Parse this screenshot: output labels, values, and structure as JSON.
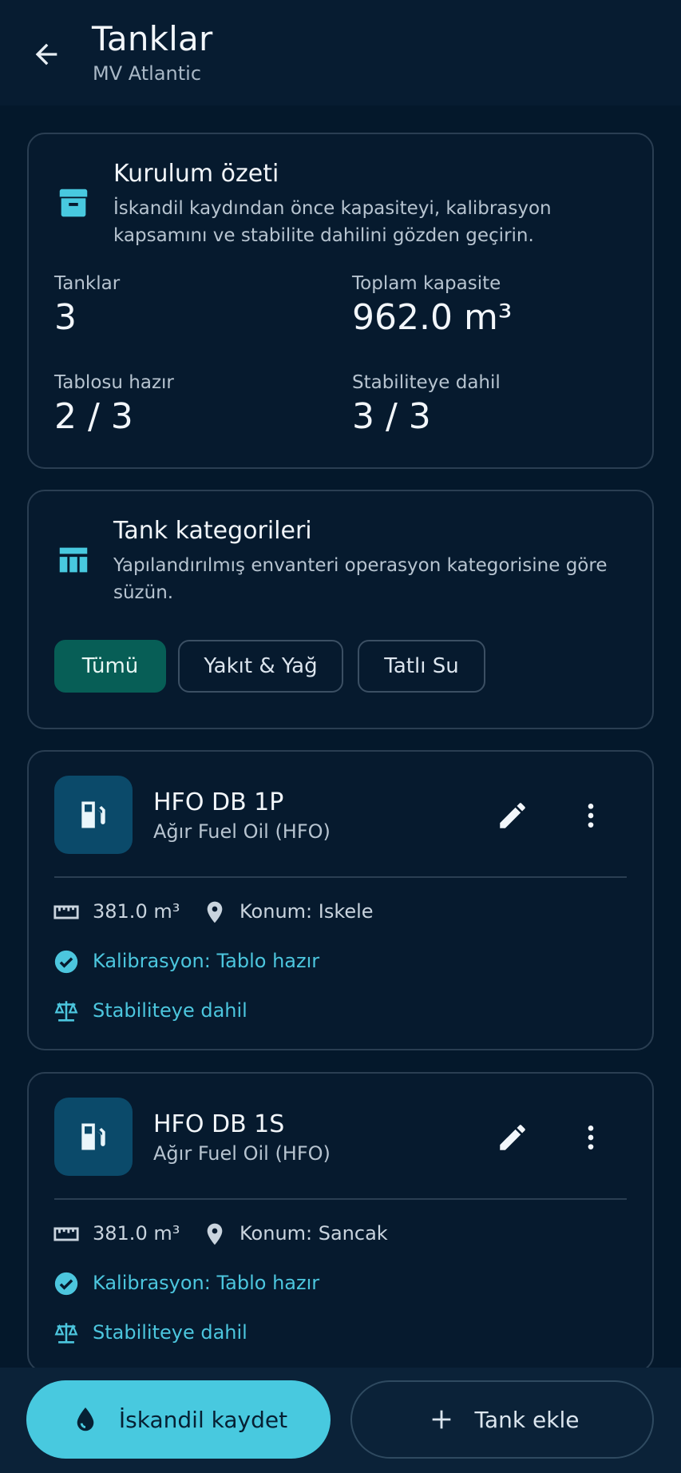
{
  "header": {
    "title": "Tanklar",
    "subtitle": "MV Atlantic",
    "back_icon": "arrow-back-icon"
  },
  "summary": {
    "title": "Kurulum özeti",
    "description": "İskandil kaydından önce kapasiteyi, kalibrasyon kapsamını ve stabilite dahilini gözden geçirin.",
    "icon": "archive-box-icon",
    "stats": [
      {
        "label": "Tanklar",
        "value": "3"
      },
      {
        "label": "Toplam kapasite",
        "value": "962.0 m³"
      },
      {
        "label": "Tablosu hazır",
        "value": "2 / 3"
      },
      {
        "label": "Stabiliteye dahil",
        "value": "3 / 3"
      }
    ]
  },
  "categories": {
    "title": "Tank kategorileri",
    "description": "Yapılandırılmış envanteri operasyon kategorisine göre süzün.",
    "icon": "table-columns-icon",
    "chips": [
      {
        "label": "Tümü",
        "selected": true
      },
      {
        "label": "Yakıt & Yağ",
        "selected": false
      },
      {
        "label": "Tatlı Su",
        "selected": false
      }
    ]
  },
  "tanks": [
    {
      "name": "HFO DB 1P",
      "type": "Ağır Fuel Oil (HFO)",
      "capacity": "381.0 m³",
      "location": "Konum: Iskele",
      "calibration": "Kalibrasyon: Tablo hazır",
      "stability": "Stabiliteye dahil"
    },
    {
      "name": "HFO DB 1S",
      "type": "Ağır Fuel Oil (HFO)",
      "capacity": "381.0 m³",
      "location": "Konum: Sancak",
      "calibration": "Kalibrasyon: Tablo hazır",
      "stability": "Stabiliteye dahil"
    }
  ],
  "actions": {
    "primary_label": "İskandil kaydet",
    "secondary_label": "Tank ekle"
  },
  "colors": {
    "background": "#04182b",
    "accent": "#48c9df",
    "chip_active": "#075e56",
    "tank_icon_bg": "#0b4a6a"
  }
}
